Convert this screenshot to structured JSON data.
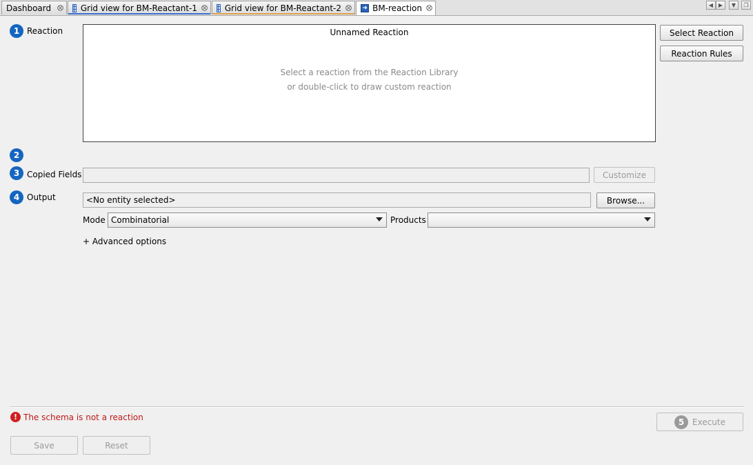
{
  "tabs": [
    {
      "label": "Dashboard"
    },
    {
      "label": "Grid view for BM-Reactant-1"
    },
    {
      "label": "Grid view for BM-Reactant-2"
    },
    {
      "label": "BM-reaction"
    }
  ],
  "steps": {
    "reaction": {
      "number": "1",
      "label": "Reaction"
    },
    "step2": {
      "number": "2"
    },
    "copied_fields": {
      "number": "3",
      "label": "Copied Fields"
    },
    "output": {
      "number": "4",
      "label": "Output"
    },
    "execute": {
      "number": "5"
    }
  },
  "reaction_panel": {
    "title": "Unnamed Reaction",
    "hint_line1": "Select a reaction from the Reaction Library",
    "hint_line2": "or double-click to draw custom reaction"
  },
  "buttons": {
    "select_reaction": "Select Reaction",
    "reaction_rules": "Reaction Rules",
    "customize": "Customize",
    "browse": "Browse...",
    "execute": "Execute",
    "save": "Save",
    "reset": "Reset"
  },
  "output": {
    "entity_value": "<No entity selected>",
    "mode_label": "Mode",
    "mode_value": "Combinatorial",
    "products_label": "Products",
    "products_value": ""
  },
  "advanced_options": "+ Advanced options",
  "error_message": "The schema is not a reaction",
  "colors": {
    "step_blue": "#1565c0",
    "error_red": "#d01f1f",
    "tab1_underline": "#3b6fcf",
    "tab2_underline": "#e0a050"
  }
}
